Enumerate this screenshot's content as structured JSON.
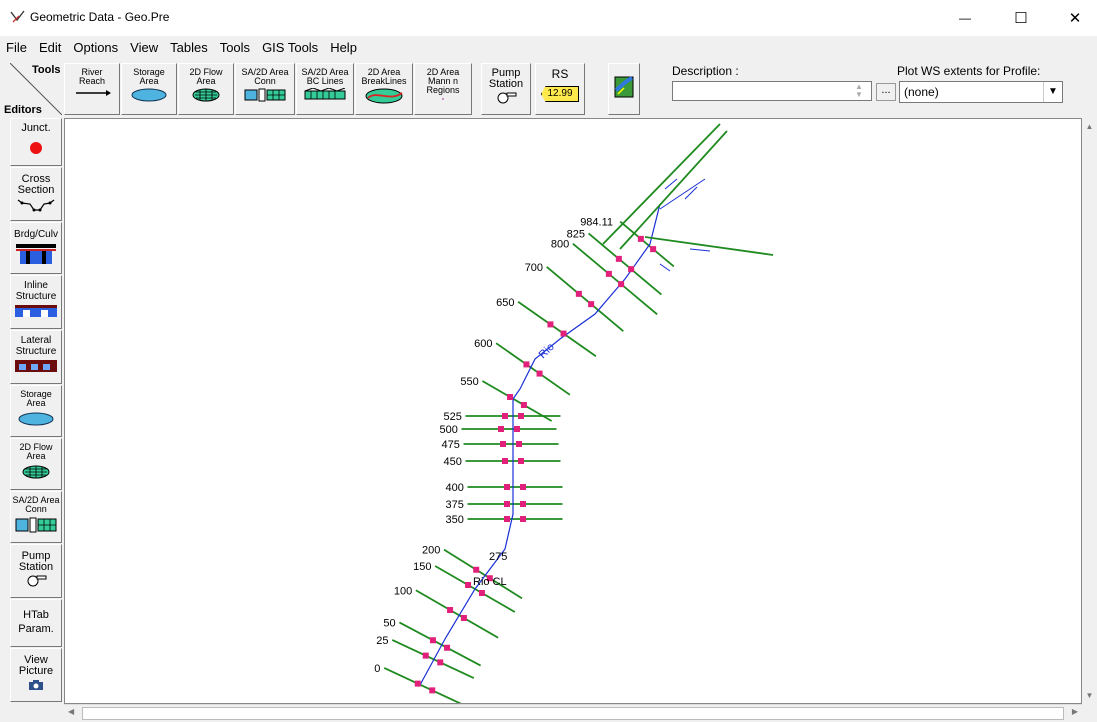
{
  "window": {
    "title": "Geometric Data - Geo.Pre",
    "minimize": "—",
    "maximize": "☐",
    "close": "✕"
  },
  "menu": [
    "File",
    "Edit",
    "Options",
    "View",
    "Tables",
    "Tools",
    "GIS Tools",
    "Help"
  ],
  "toolbar": {
    "tools_label": "Tools",
    "editors_label": "Editors",
    "buttons": [
      {
        "label": "River\nReach",
        "icon": "river-reach-icon"
      },
      {
        "label": "Storage\nArea",
        "icon": "storage-area-icon"
      },
      {
        "label": "2D Flow\nArea",
        "icon": "2d-flow-area-icon"
      },
      {
        "label": "SA/2D Area\nConn",
        "icon": "sa-2d-conn-icon"
      },
      {
        "label": "SA/2D Area\nBC Lines",
        "icon": "bc-lines-icon"
      },
      {
        "label": "2D Area\nBreakLines",
        "icon": "breaklines-icon"
      },
      {
        "label": "2D Area\nMann n\nRegions",
        "icon": "mann-regions-icon"
      },
      {
        "label": "Pump\nStation",
        "icon": "pump-station-icon"
      },
      {
        "label": "RS",
        "value": "12.99",
        "icon": "rs-tag-icon"
      },
      {
        "label": "",
        "icon": "background-map-icon"
      }
    ],
    "description_label": "Description :",
    "description_value": "",
    "description_button": "...",
    "plot_ws_label": "Plot WS extents for Profile:",
    "plot_ws_value": "(none)"
  },
  "editors": [
    {
      "label": "Junct.",
      "icon": "junction-icon"
    },
    {
      "label": "Cross\nSection",
      "icon": "cross-section-icon"
    },
    {
      "label": "Brdg/Culv",
      "icon": "bridge-icon"
    },
    {
      "label": "Inline\nStructure",
      "icon": "inline-structure-icon"
    },
    {
      "label": "Lateral\nStructure",
      "icon": "lateral-structure-icon"
    },
    {
      "label": "Storage\nArea",
      "icon": "storage-area-icon"
    },
    {
      "label": "2D Flow\nArea",
      "icon": "2d-flow-area-icon"
    },
    {
      "label": "SA/2D Area\nConn",
      "icon": "sa-2d-conn-icon"
    },
    {
      "label": "Pump\nStation",
      "icon": "pump-station-icon"
    },
    {
      "label": "HTab\nParam.",
      "icon": ""
    },
    {
      "label": "View\nPicture",
      "icon": "camera-icon"
    }
  ],
  "river": {
    "reach_label": "Rio CL",
    "river_label": "Rio",
    "stations": [
      "0",
      "25",
      "50",
      "100",
      "150",
      "200",
      "275",
      "350",
      "375",
      "400",
      "450",
      "475",
      "500",
      "525",
      "550",
      "600",
      "650",
      "700",
      "800",
      "825",
      "984.11"
    ],
    "colors": {
      "river": "#1a2fd6",
      "cross_section": "#1f8a1f",
      "bank": "#e0207a"
    }
  }
}
